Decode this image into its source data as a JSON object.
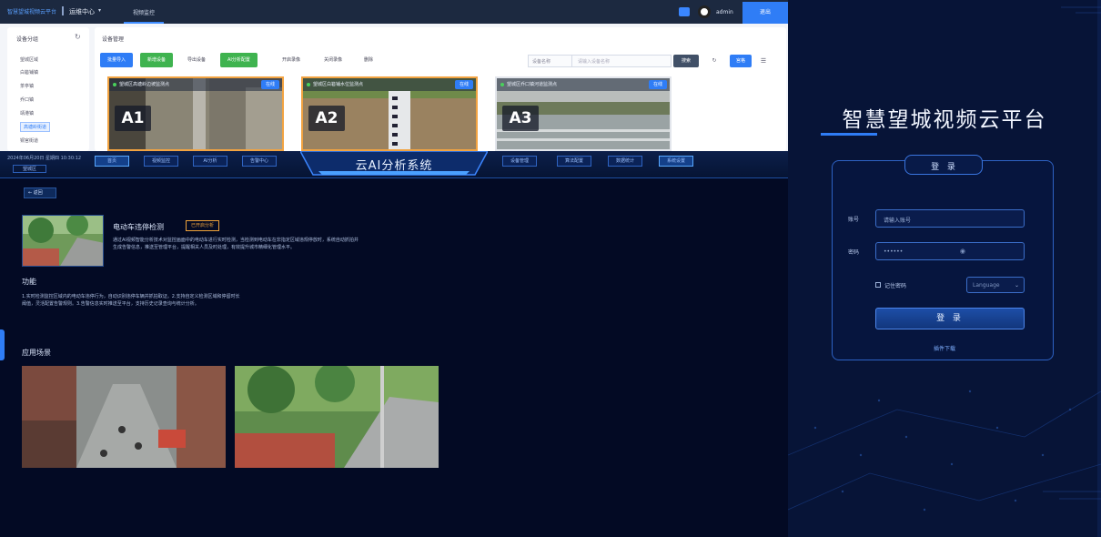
{
  "admin": {
    "brand": "智慧望城视频云平台",
    "module": "运维中心",
    "module_arrow": "▾",
    "nav_active": "视频监控",
    "user": "admin",
    "exit_label": "退出",
    "sidebar": {
      "title": "设备分组",
      "items": [
        "望城区域",
        "白箬铺镇",
        "茶亭镇",
        "乔口镇",
        "靖港镇",
        "高塘岭街道",
        "铜官街道"
      ],
      "active_index": 5
    },
    "main_title": "设备管理",
    "toolbar": [
      "批量导入",
      "新增设备",
      "导出设备",
      "AI分析配置",
      "开启录像",
      "关闭录像",
      "删除"
    ],
    "search_select": "设备名称",
    "search_placeholder": "请输入设备名称",
    "search_label": "搜索",
    "reset_label": "↻",
    "grid_label": "宫格",
    "list_label": "☰",
    "cameras": [
      {
        "name": "望城区高塘岭边坡监测点",
        "code": "A1",
        "live": "在线"
      },
      {
        "name": "望城区白箬铺水位监测点",
        "code": "A2",
        "live": "在线"
      },
      {
        "name": "望城区乔口镇河道监测点",
        "code": "A3",
        "live": "在线"
      }
    ]
  },
  "ai": {
    "header_left": "2024年06月20日 星期四 10:30:12",
    "header_sub": "望城区",
    "nav_left": [
      "首页",
      "视频监控",
      "AI分析",
      "告警中心"
    ],
    "nav_right": [
      "设备管理",
      "算法配置",
      "数据统计",
      "系统设置"
    ],
    "title": "云AI分析系统",
    "back_label": "返回",
    "device_name": "电动车违停检测",
    "device_badge": "已开启分析",
    "description": "通过AI视频智能分析技术对监控画面中的电动车进行实时检测，当检测到电动车在非指定区域违规停放时，系统自动抓拍并生成告警信息，推送至管理平台，提醒相关人员及时处理，有效提升城市精细化管理水平。",
    "func_title": "功能",
    "func_text": "1.实时检测监控区域内的电动车违停行为，自动识别违停车辆并抓拍取证。2.支持自定义检测区域和停留时长阈值，灵活配置告警规则。3.告警信息实时推送至平台，支持历史记录查询与统计分析。",
    "cases_title": "应用场景"
  },
  "login": {
    "platform_title": "智慧望城视频云平台",
    "box_title": "登 录",
    "username_label": "账号",
    "username_value": "请输入账号",
    "password_label": "密码",
    "password_value": "••••••",
    "password_eye": "◉",
    "remember_label": "记住密码",
    "language_placeholder": "Language",
    "language_arrow": "⌄",
    "login_button": "登 录",
    "download_link": "插件下载"
  },
  "colors": {
    "accent": "#2f7df6",
    "green": "#3fb34f",
    "orange": "#f2a341",
    "dark_bg": "#030a24"
  }
}
